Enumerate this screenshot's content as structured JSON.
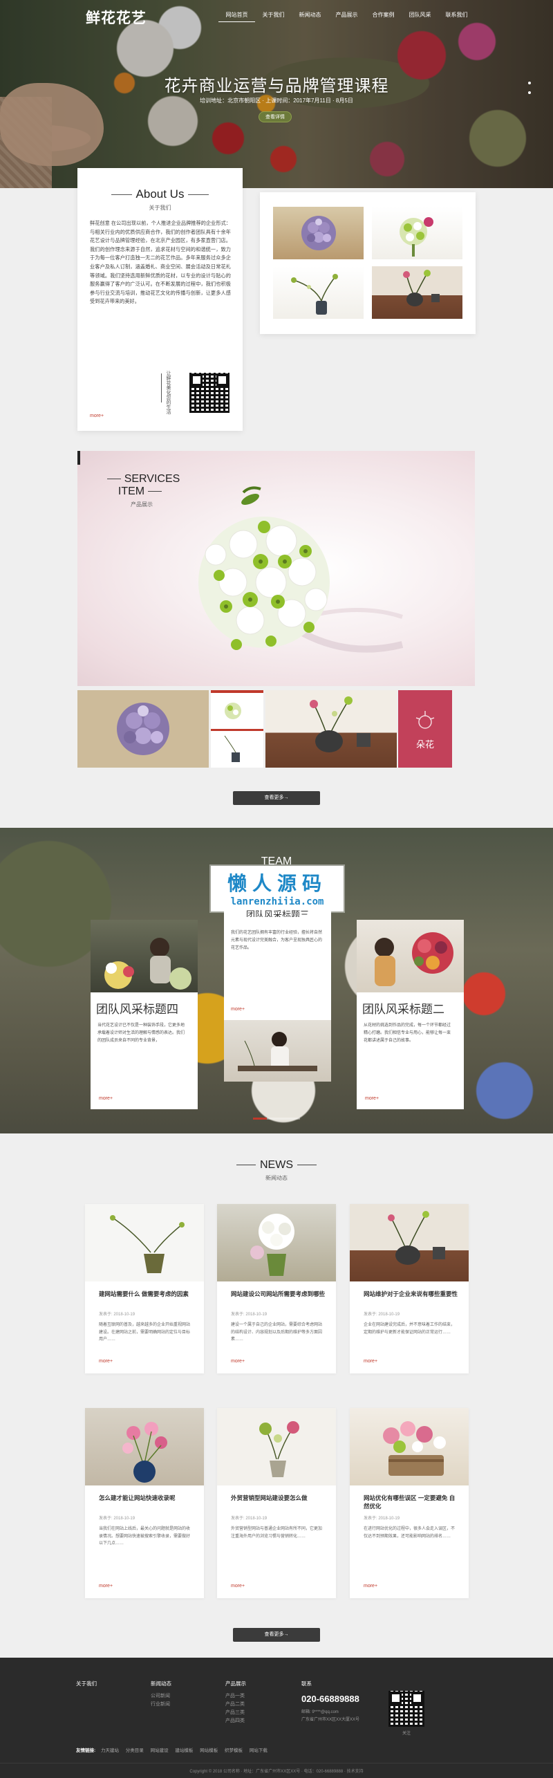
{
  "header": {
    "logo": "鲜花花艺",
    "nav": [
      "网站首页",
      "关于我们",
      "新闻动态",
      "产品展示",
      "合作案例",
      "团队风采",
      "联系我们"
    ]
  },
  "hero": {
    "title": "花卉商业运营与品牌管理课程",
    "subtitle": "培训地址：北京市朝阳区 · 上课时间：2017年7月11日 · 8月5日",
    "button": "查看详情"
  },
  "about": {
    "title_en": "About Us",
    "title_cn": "关于我们",
    "text": "鲜花创意 在公司出现以前，个人推进企业品牌推荐的企业形式：与相关行业内的优质供应商合作，我们的创作者团队具有十余年花艺设计与品牌管理经验，在北京产业园区，有多家直营门店。我们的创作理念来源于自然，追求花材与空间的和谐统一，致力于为每一位客户打造独一无二的花艺作品。多年来服务过众多企业客户及私人订制，涵盖婚礼、商业空间、展会活动及日常花礼等领域。我们坚持选用新鲜优质的花材，以专业的设计与贴心的服务赢得了客户的广泛认可。在不断发展的过程中，我们也积极参与行业交流与培训，推动花艺文化的传播与创新，让更多人感受到花卉带来的美好。",
    "vertical_label": "让鲜花美化您的生活",
    "more": "more+"
  },
  "services": {
    "title_en": "SERVICES ITEM",
    "title_cn": "产品展示",
    "brand_char": "朵花",
    "button": "查看更多→"
  },
  "team": {
    "title": "TEAM",
    "watermark_cn": "懒人源码",
    "watermark_url": "lanrenzhijia.com",
    "cards": [
      {
        "title": "团队风采标题四",
        "text": "当代花艺设计已不仅是一种装饰手段，它更多地承载着设计师对生活的理解与情感的表达。我们的团队成员来自不同的专业背景，",
        "more": "more+"
      },
      {
        "title": "团队风采标题三",
        "text": "我们的花艺团队拥有丰富的行业经验，擅长将自然元素与现代设计完美融合，为客户呈现独具匠心的花艺作品。",
        "more": "more+"
      },
      {
        "title": "团队风采标题二",
        "text": "从花材的挑选到作品的完成，每一个环节都经过精心打磨。我们相信专业与用心，能够让每一束花都讲述属于自己的故事。",
        "more": "more+"
      }
    ]
  },
  "news": {
    "title_en": "NEWS",
    "title_cn": "新闻动态",
    "items": [
      {
        "title": "建网站需要什么 做需要考虑的因素",
        "date": "发表于: 2018-10-19",
        "desc": "随着互联网的普及，越来越多的企业开始重视网站建设。在建网站之前，需要明确网站的定位与目标用户……",
        "more": "more+"
      },
      {
        "title": "网站建设公司网站所需要考虑到哪些",
        "date": "发表于: 2018-10-19",
        "desc": "建设一个属于自己的企业网站，需要综合考虑网站的结构设计、内容规划以及后期的维护等多方面因素……",
        "more": "more+"
      },
      {
        "title": "网站维护对于企业来说有哪些重要性",
        "date": "发表于: 2018-10-19",
        "desc": "企业在网站建设完成后，并不意味着工作的结束，定期的维护与更新才能保证网站的正常运行……",
        "more": "more+"
      },
      {
        "title": "怎么建才能让网站快速收录呢",
        "date": "发表于: 2018-10-19",
        "desc": "当我们在网站上线后，最关心的问题就是网站的收录情况。想要网站快速被搜索引擎收录，需要做好以下几点……",
        "more": "more+"
      },
      {
        "title": "外贸营销型网站建设要怎么做",
        "date": "发表于: 2018-10-19",
        "desc": "外贸营销型网站与普通企业网站有所不同，它更加注重海外用户的浏览习惯与营销转化……",
        "more": "more+"
      },
      {
        "title": "网站优化有哪些误区 一定要避免 自然优化",
        "date": "发表于: 2018-10-19",
        "desc": "在进行网站优化的过程中，很多人会走入误区，不仅达不到预期效果，还可能影响网站的排名……",
        "more": "more+"
      }
    ],
    "button": "查看更多→"
  },
  "footer": {
    "columns": [
      {
        "heading": "关于我们",
        "items": []
      },
      {
        "heading": "新闻动态",
        "items": [
          "公司新闻",
          "行业新闻"
        ]
      },
      {
        "heading": "产品展示",
        "items": [
          "产品一类",
          "产品二类",
          "产品三类",
          "产品四类"
        ]
      },
      {
        "heading": "联系",
        "items": []
      }
    ],
    "phone": "020-66889888",
    "address_lines": [
      "邮箱: 9****@qq.com",
      "广东省广州市XX区XX大厦XX号"
    ],
    "qr_caption": "关注",
    "links_label": "友情链接:",
    "links": [
      "力天建站",
      "分类目录",
      "网站建设",
      "建站模板",
      "网站模板",
      "织梦模板",
      "网站下载"
    ],
    "copyright": "Copyright © 2018 公司名称 · 地址：广东省广州市XX区XX号 · 电话：020-66889888 · 技术支持"
  },
  "colors": {
    "accent": "#c0392b",
    "dark": "#2b2b2b",
    "button": "#3b3b3b"
  }
}
